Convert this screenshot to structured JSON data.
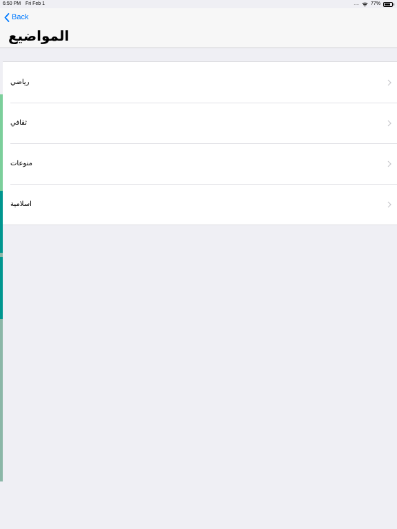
{
  "status_bar": {
    "time": "6:50 PM",
    "date": "Fri Feb 1",
    "battery": "77%",
    "battery_level": 0.77,
    "signal_dots": "....",
    "icons": [
      "wifi-icon",
      "battery-icon"
    ]
  },
  "nav": {
    "back_label": "Back",
    "back_icon": "chevron-left-icon",
    "title": "المواضيع"
  },
  "topics": [
    {
      "label": "رياضي",
      "icon": "chevron-right-icon"
    },
    {
      "label": "ثقافي",
      "icon": "chevron-right-icon"
    },
    {
      "label": "منوعات",
      "icon": "chevron-right-icon"
    },
    {
      "label": "اسلامية",
      "icon": "chevron-right-icon"
    }
  ],
  "colors": {
    "accent": "#007aff",
    "background": "#efeff4",
    "strip_green": "#7ccf9b",
    "strip_teal": "#00968f",
    "strip_gray_green": "#8bb7a7"
  }
}
